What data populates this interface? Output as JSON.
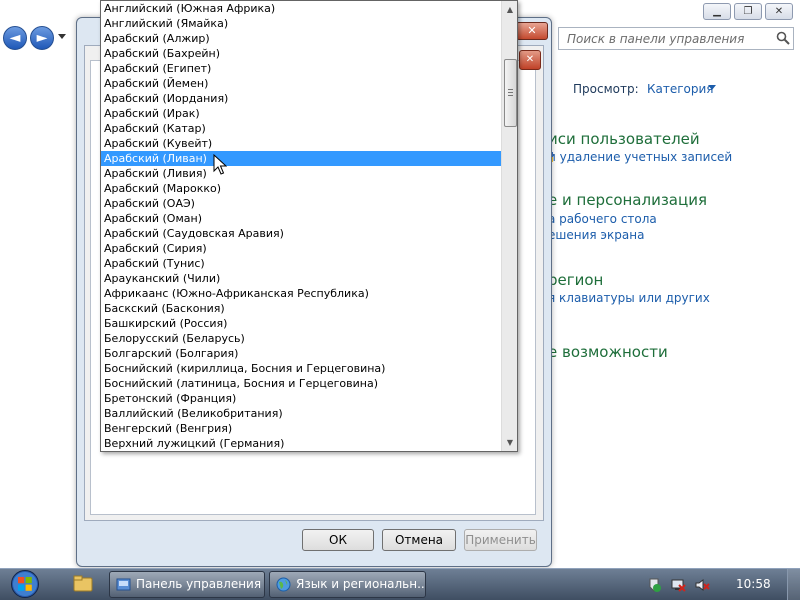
{
  "control_panel": {
    "search_placeholder": "Поиск в панели управления",
    "view_label": "Просмотр:",
    "view_value": "Категория",
    "sections": [
      {
        "heading": "иси пользователей",
        "links": [
          "и удаление учетных записей"
        ]
      },
      {
        "heading": "е и персонализация",
        "links": [
          "а рабочего стола",
          "ешения экрана"
        ]
      },
      {
        "heading": "регион",
        "links": [
          "я клавиатуры или других"
        ]
      },
      {
        "heading": "е возможности",
        "links": []
      }
    ]
  },
  "dialog": {
    "buttons": {
      "ok": "ОК",
      "cancel": "Отмена",
      "apply": "Применить"
    }
  },
  "language_list": {
    "selected_index": 10,
    "items": [
      "Английский (Южная Африка)",
      "Английский (Ямайка)",
      "Арабский (Алжир)",
      "Арабский (Бахрейн)",
      "Арабский (Египет)",
      "Арабский (Йемен)",
      "Арабский (Иордания)",
      "Арабский (Ирак)",
      "Арабский (Катар)",
      "Арабский (Кувейт)",
      "Арабский (Ливан)",
      "Арабский (Ливия)",
      "Арабский (Марокко)",
      "Арабский (ОАЭ)",
      "Арабский (Оман)",
      "Арабский (Саудовская Аравия)",
      "Арабский (Сирия)",
      "Арабский (Тунис)",
      "Арауканский (Чили)",
      "Африкаанс (Южно-Африканская Республика)",
      "Баскский (Баскония)",
      "Башкирский (Россия)",
      "Белорусский (Беларусь)",
      "Болгарский (Болгария)",
      "Боснийский (кириллица, Босния и Герцеговина)",
      "Боснийский (латиница, Босния и Герцеговина)",
      "Бретонский (Франция)",
      "Валлийский (Великобритания)",
      "Венгерский (Венгрия)",
      "Верхний лужицкий (Германия)"
    ]
  },
  "taskbar": {
    "tasks": [
      "Панель управления",
      "Язык и региональн..."
    ],
    "clock": "10:58"
  },
  "colors": {
    "selection": "#3399ff",
    "link": "#1c5dab",
    "heading_green": "#1e6e3a"
  }
}
